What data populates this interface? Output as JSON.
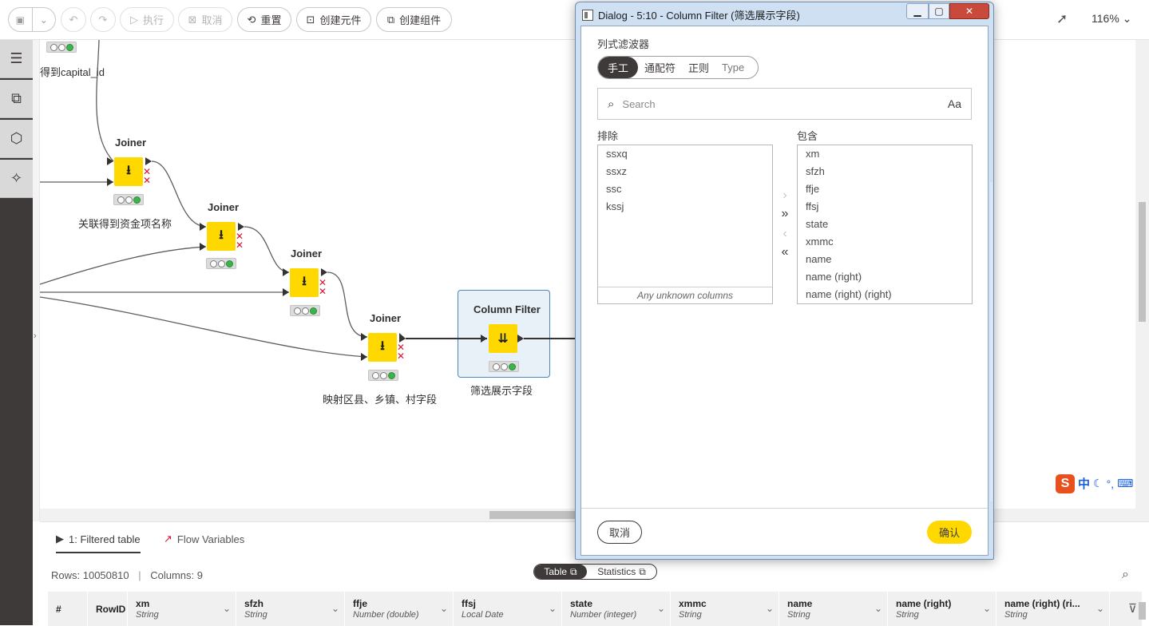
{
  "toolbar": {
    "execute_label": "执行",
    "cancel_label": "取消",
    "reset_label": "重置",
    "create_metanode_label": "创建元件",
    "create_component_label": "创建组件",
    "zoom": "116%"
  },
  "canvas": {
    "partial_label": "得到capital_id",
    "nodes": [
      {
        "title": "Joiner",
        "label": "关联得到资金项名称"
      },
      {
        "title": "Joiner",
        "label": ""
      },
      {
        "title": "Joiner",
        "label": ""
      },
      {
        "title": "Joiner",
        "label": "映射区县、乡镇、村字段"
      },
      {
        "title": "Column Filter",
        "label": "筛选展示字段"
      }
    ]
  },
  "bottom": {
    "tab_table": "1: Filtered table",
    "tab_flowvars": "Flow Variables",
    "rows_label": "Rows: 10050810",
    "cols_label": "Columns: 9",
    "seg_table": "Table",
    "seg_stats": "Statistics",
    "columns": [
      {
        "name": "#",
        "type": ""
      },
      {
        "name": "RowID",
        "type": ""
      },
      {
        "name": "xm",
        "type": "String"
      },
      {
        "name": "sfzh",
        "type": "String"
      },
      {
        "name": "ffje",
        "type": "Number (double)"
      },
      {
        "name": "ffsj",
        "type": "Local Date"
      },
      {
        "name": "state",
        "type": "Number (integer)"
      },
      {
        "name": "xmmc",
        "type": "String"
      },
      {
        "name": "name",
        "type": "String"
      },
      {
        "name": "name (right)",
        "type": "String"
      },
      {
        "name": "name (right) (ri...",
        "type": "String"
      }
    ]
  },
  "dialog": {
    "title": "Dialog - 5:10 - Column Filter (筛选展示字段)",
    "section_title": "列式滤波器",
    "modes": [
      "手工",
      "通配符",
      "正则",
      "Type"
    ],
    "search_placeholder": "Search",
    "case_toggle": "Aa",
    "exclude_label": "排除",
    "include_label": "包含",
    "excluded": [
      "ssxq",
      "ssxz",
      "ssc",
      "kssj"
    ],
    "included": [
      "xm",
      "sfzh",
      "ffje",
      "ffsj",
      "state",
      "xmmc",
      "name",
      "name (right)",
      "name (right) (right)"
    ],
    "unknown_columns": "Any unknown columns",
    "cancel_label": "取消",
    "ok_label": "确认"
  },
  "ime": {
    "lang": "中"
  },
  "colors": {
    "node_yellow": "#ffd800",
    "dark": "#3e3a39",
    "selection_blue": "#4d86c5",
    "error_red": "#e0112d",
    "ok_green": "#3cb44b"
  }
}
